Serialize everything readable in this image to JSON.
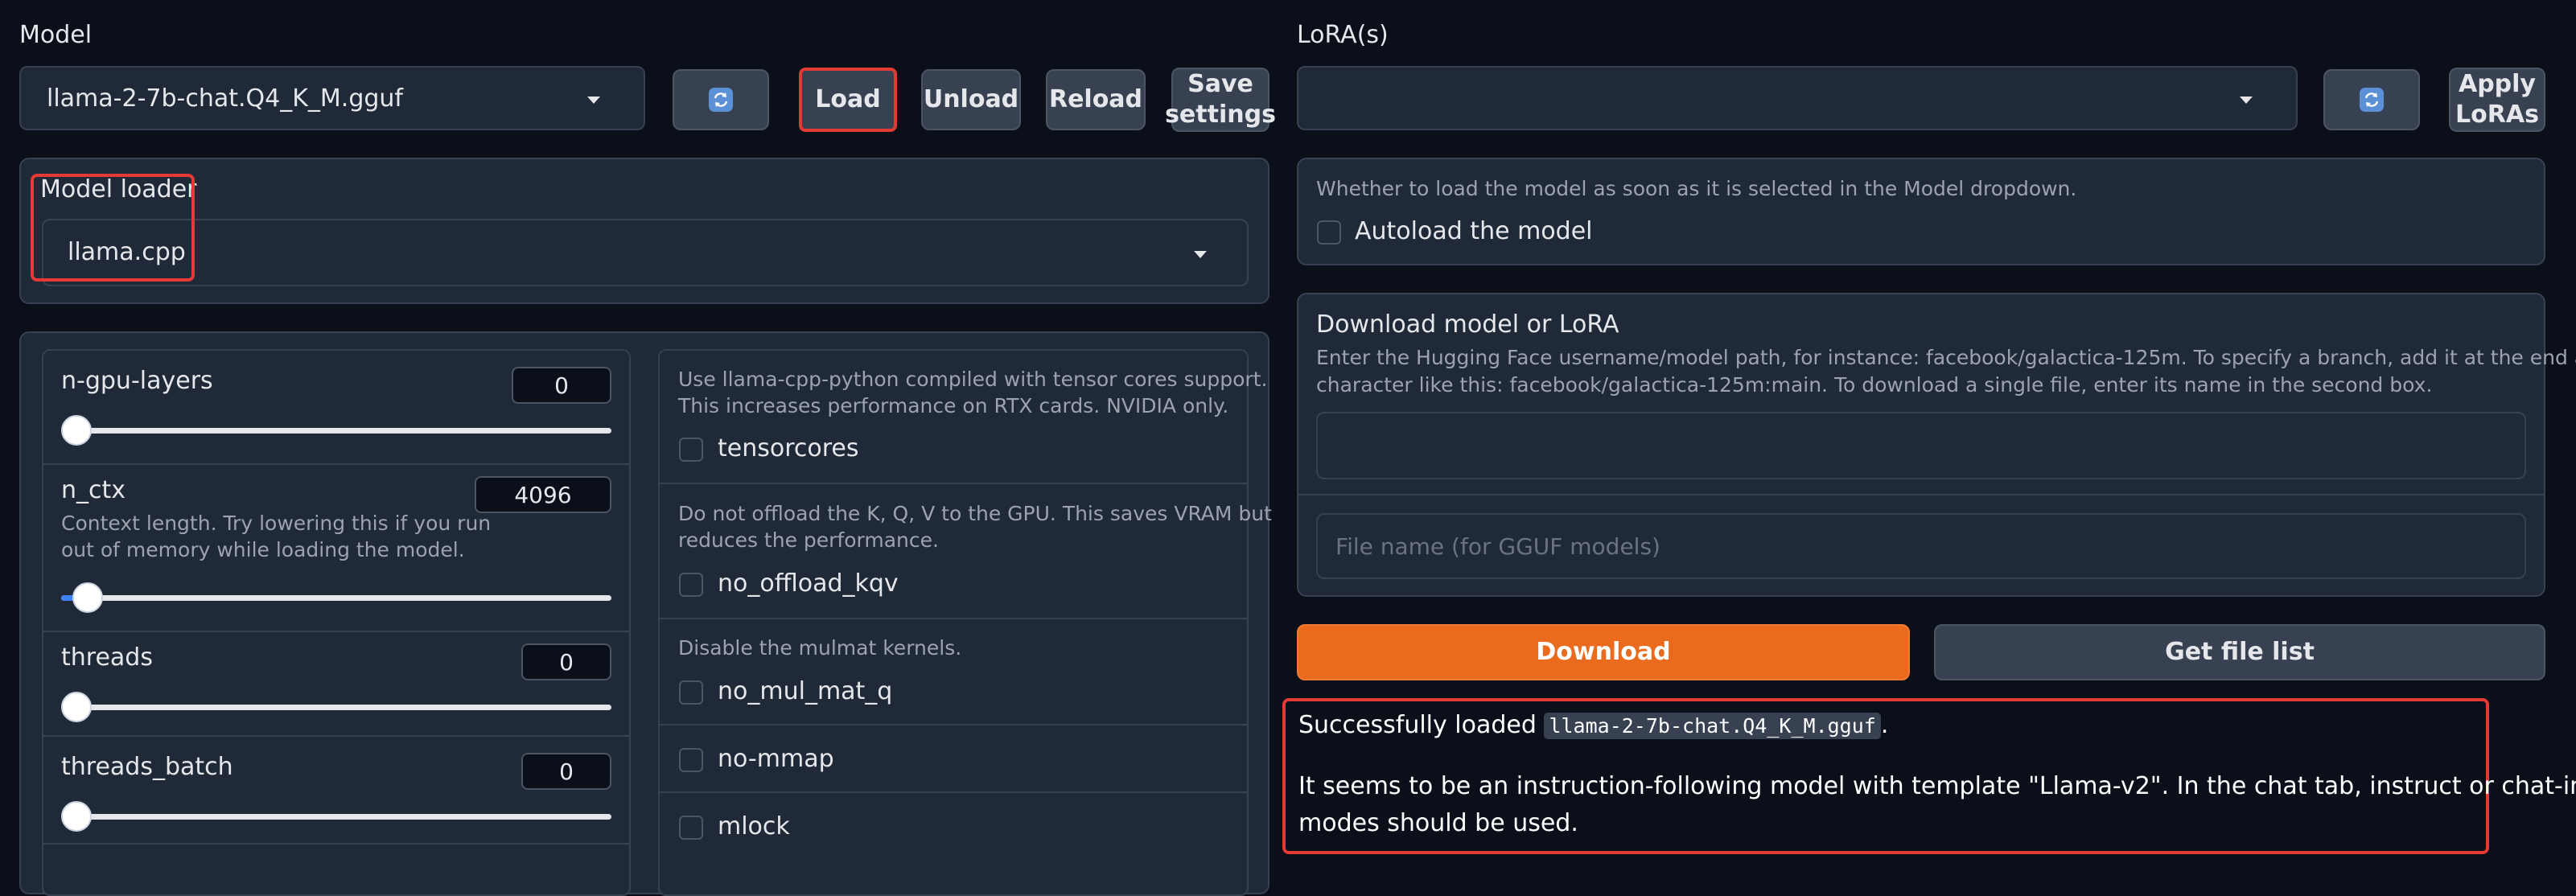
{
  "model": {
    "label": "Model",
    "selected": "llama-2-7b-chat.Q4_K_M.gguf",
    "refresh_icon": "refresh-icon",
    "load": "Load",
    "unload": "Unload",
    "reload": "Reload",
    "save_line1": "Save",
    "save_line2": "settings"
  },
  "lora": {
    "label": "LoRA(s)",
    "selected": "",
    "apply_line1": "Apply",
    "apply_line2": "LoRAs"
  },
  "loader": {
    "label": "Model loader",
    "selected": "llama.cpp"
  },
  "params": {
    "n_gpu_layers": {
      "label": "n-gpu-layers",
      "value": "0",
      "fraction": 0.0
    },
    "n_ctx": {
      "label": "n_ctx",
      "value": "4096",
      "fraction": 0.05,
      "desc_line1": "Context length. Try lowering this if you run",
      "desc_line2": "out of memory while loading the model."
    },
    "threads": {
      "label": "threads",
      "value": "0",
      "fraction": 0.0
    },
    "threads_batch": {
      "label": "threads_batch",
      "value": "0",
      "fraction": 0.0
    }
  },
  "options": {
    "tensorcores_desc1": "Use llama-cpp-python compiled with tensor cores support.",
    "tensorcores_desc2": "This increases performance on RTX cards. NVIDIA only.",
    "tensorcores": "tensorcores",
    "no_offload_desc1": "Do not offload the K, Q, V to the GPU. This saves VRAM but",
    "no_offload_desc2": "reduces the performance.",
    "no_offload_kqv": "no_offload_kqv",
    "mulmat_desc": "Disable the mulmat kernels.",
    "no_mul_mat_q": "no_mul_mat_q",
    "no_mmap": "no-mmap",
    "mlock": "mlock"
  },
  "autoload": {
    "desc": "Whether to load the model as soon as it is selected in the Model dropdown.",
    "label": "Autoload the model"
  },
  "download": {
    "title": "Download model or LoRA",
    "desc_line1": "Enter the Hugging Face username/model path, for instance: facebook/galactica-125m. To specify a branch, add it at the end after a \":\"",
    "desc_line2": "character like this: facebook/galactica-125m:main. To download a single file, enter its name in the second box.",
    "path_value": "",
    "file_placeholder": "File name (for GGUF models)",
    "download_button": "Download",
    "file_list_button": "Get file list"
  },
  "status": {
    "prefix": "Successfully loaded ",
    "model_code": "llama-2-7b-chat.Q4_K_M.gguf",
    "suffix": ".",
    "line2": "It seems to be an instruction-following model with template \"Llama-v2\". In the chat tab, instruct or chat-instruct",
    "line3": "modes should be used."
  },
  "colors": {
    "background": "#0b0f19",
    "panel": "#1f2937",
    "accent": "#ea6b1e",
    "highlight": "#e53935",
    "slider_fill": "#3b82f6"
  }
}
